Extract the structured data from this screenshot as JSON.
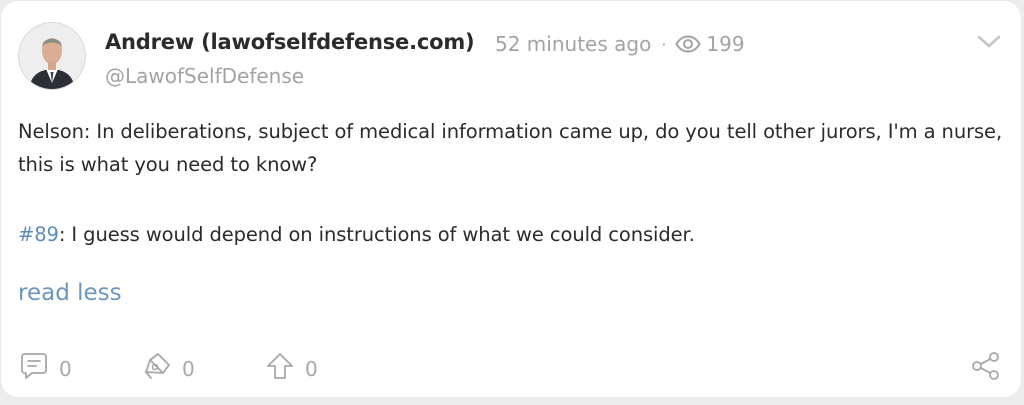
{
  "post": {
    "author_name": "Andrew (lawofselfdefense.com)",
    "handle": "@LawofSelfDefense",
    "time_ago": "52 minutes ago",
    "separator": "·",
    "views": "199",
    "paragraph1": "Nelson: In deliberations, subject of medical information came up, do you tell other jurors, I'm a nurse, this is what you need to know?",
    "hashtag": "#89",
    "paragraph2_rest": ": I guess would depend on instructions of what we could consider.",
    "read_less": "read less"
  },
  "actions": {
    "comments": "0",
    "reposts": "0",
    "upvotes": "0"
  },
  "icons": {
    "views": "eye-icon",
    "menu": "chevron-down-icon",
    "comments": "comment-icon",
    "reposts": "repost-icon",
    "upvotes": "upvote-arrow-icon",
    "share": "share-icon"
  },
  "colors": {
    "text": "#2b2b2b",
    "muted": "#a3a3a3",
    "link": "#5d8db7",
    "card": "#ffffff",
    "background": "#ececec"
  }
}
